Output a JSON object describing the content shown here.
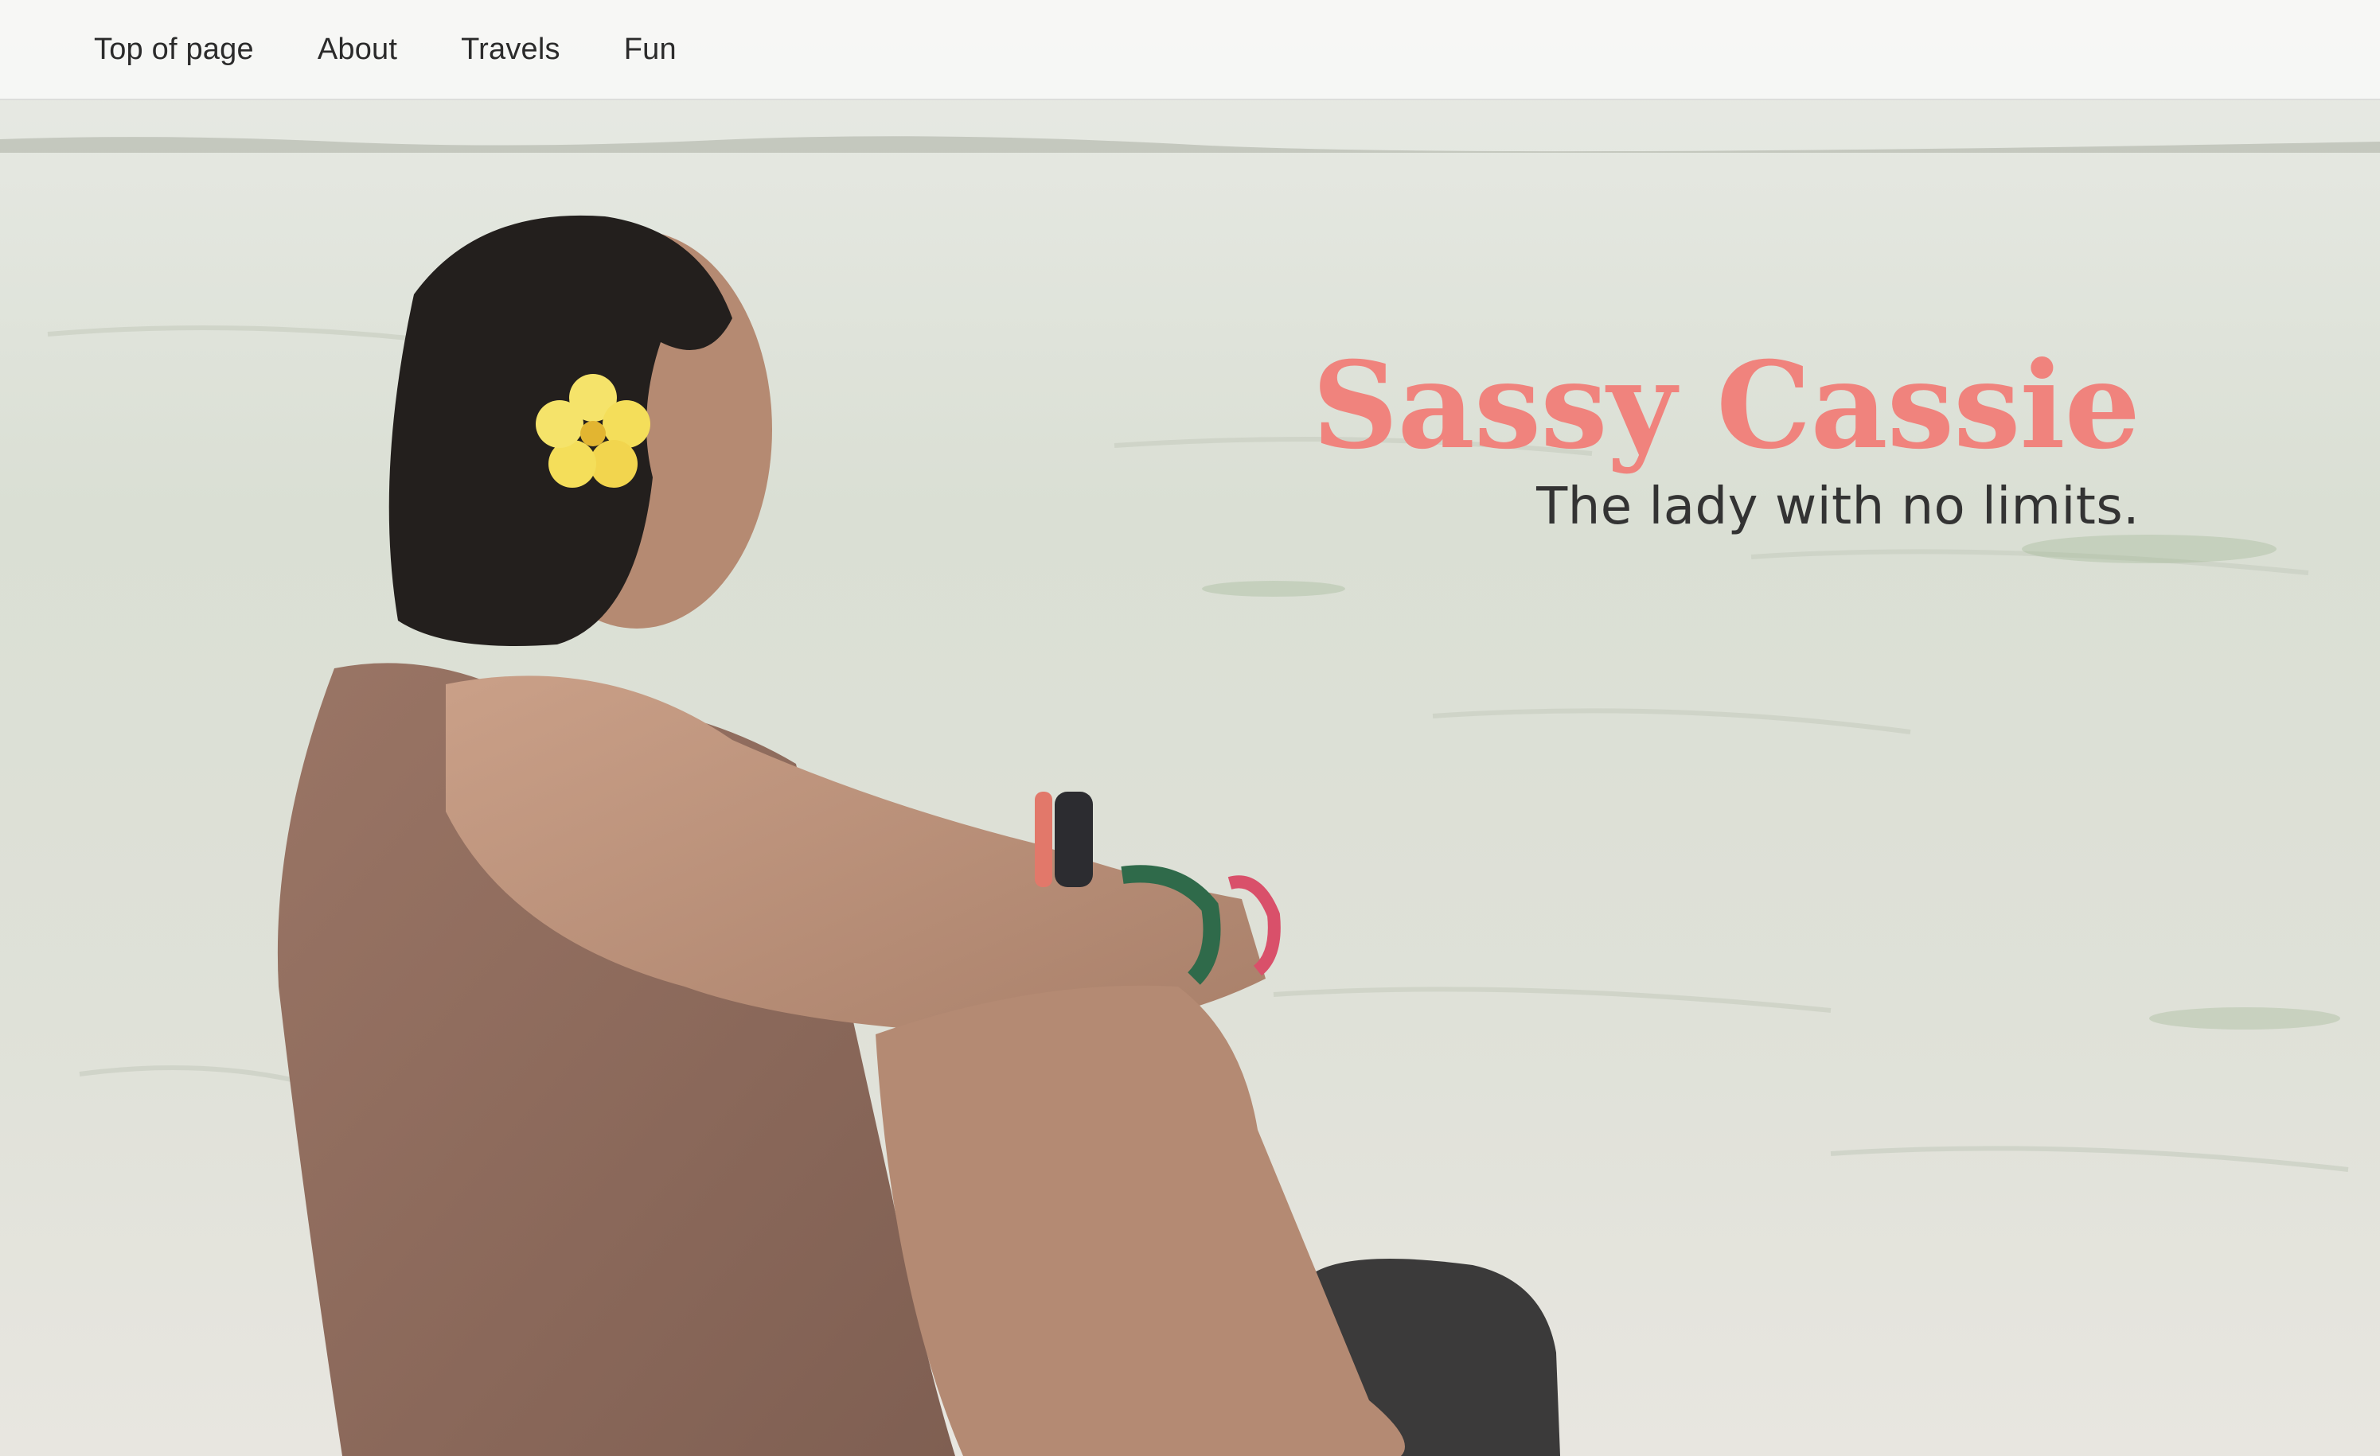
{
  "nav": {
    "items": [
      {
        "label": "Top of page"
      },
      {
        "label": "About"
      },
      {
        "label": "Travels"
      },
      {
        "label": "Fun"
      }
    ]
  },
  "hero": {
    "title": "Sassy Cassie",
    "subtitle": "The lady with no limits.",
    "colors": {
      "title": "#f0837d",
      "subtitle": "#333333"
    }
  }
}
